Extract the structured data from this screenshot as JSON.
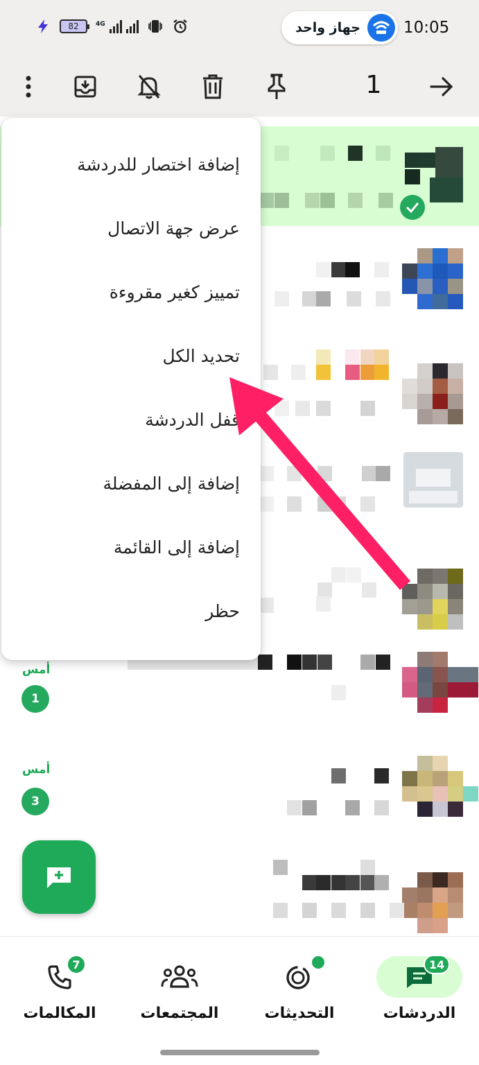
{
  "status_bar": {
    "battery": "82",
    "network": "4G",
    "wifi_label": "جهاز واحد",
    "time": "10:05"
  },
  "action_bar": {
    "selected_count": "1",
    "icons": [
      "back-arrow-icon",
      "pin-icon",
      "trash-icon",
      "mute-bell-icon",
      "archive-icon",
      "more-vert-icon"
    ]
  },
  "menu": {
    "items": [
      "إضافة اختصار للدردشة",
      "عرض جهة الاتصال",
      "تمييز كغير مقروءة",
      "تحديد الكل",
      "قفل الدردشة",
      "إضافة إلى المفضلة",
      "إضافة إلى القائمة",
      "حظر"
    ]
  },
  "chats": [
    {
      "time": "أمس",
      "unread": "1"
    },
    {
      "time": "أمس",
      "unread": "3"
    }
  ],
  "bottom_nav": {
    "tabs": [
      {
        "label": "الدردشات",
        "badge": "14",
        "icon": "chats-icon"
      },
      {
        "label": "التحديثات",
        "icon": "updates-icon"
      },
      {
        "label": "المجتمعات",
        "icon": "communities-icon"
      },
      {
        "label": "المكالمات",
        "badge": "7",
        "icon": "calls-icon"
      }
    ]
  },
  "colors": {
    "accent": "#1faa59",
    "selected_row": "#d9fdd3",
    "annotation_arrow": "#ff1f65"
  }
}
